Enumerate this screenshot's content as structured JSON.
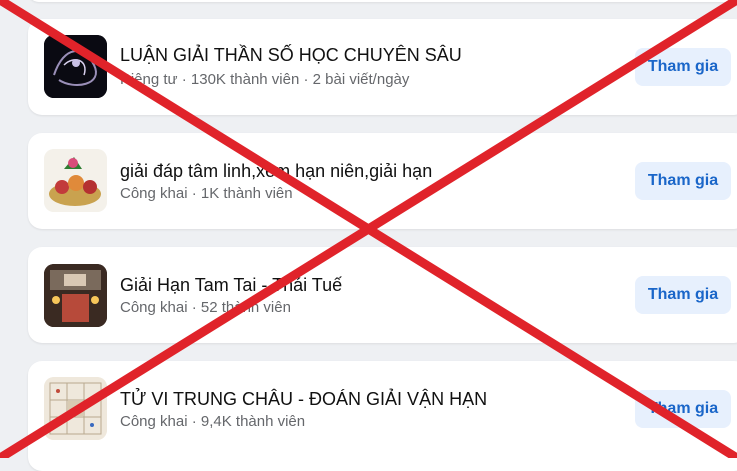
{
  "groups": [
    {
      "title": "LUẬN GIẢI THẦN SỐ HỌC CHUYÊN SÂU",
      "meta": "Riêng tư · 130K thành viên · 2 bài viết/ngày",
      "join_label": "Tham gia",
      "thumbnail": "dark-swirl-image"
    },
    {
      "title": "giải đáp tâm linh,xem hạn niên,giải hạn",
      "meta": "Công khai · 1K thành viên",
      "join_label": "Tham gia",
      "thumbnail": "offering-tray-image"
    },
    {
      "title": "Giải Hạn Tam Tai - Thái Tuế",
      "meta": "Công khai · 52 thành viên",
      "join_label": "Tham gia",
      "thumbnail": "altar-candles-image"
    },
    {
      "title": "TỬ VI TRUNG CHÂU - ĐOÁN GIẢI VẬN HẠN",
      "meta": "Công khai · 9,4K thành viên",
      "join_label": "Tham gia",
      "thumbnail": "astrology-chart-image"
    }
  ],
  "overlay": {
    "mark": "red-x-cross",
    "color": "#e0232a"
  },
  "colors": {
    "join_bg": "#e7f0fd",
    "join_text": "#1a66c9",
    "page_bg": "#eef0f3"
  }
}
